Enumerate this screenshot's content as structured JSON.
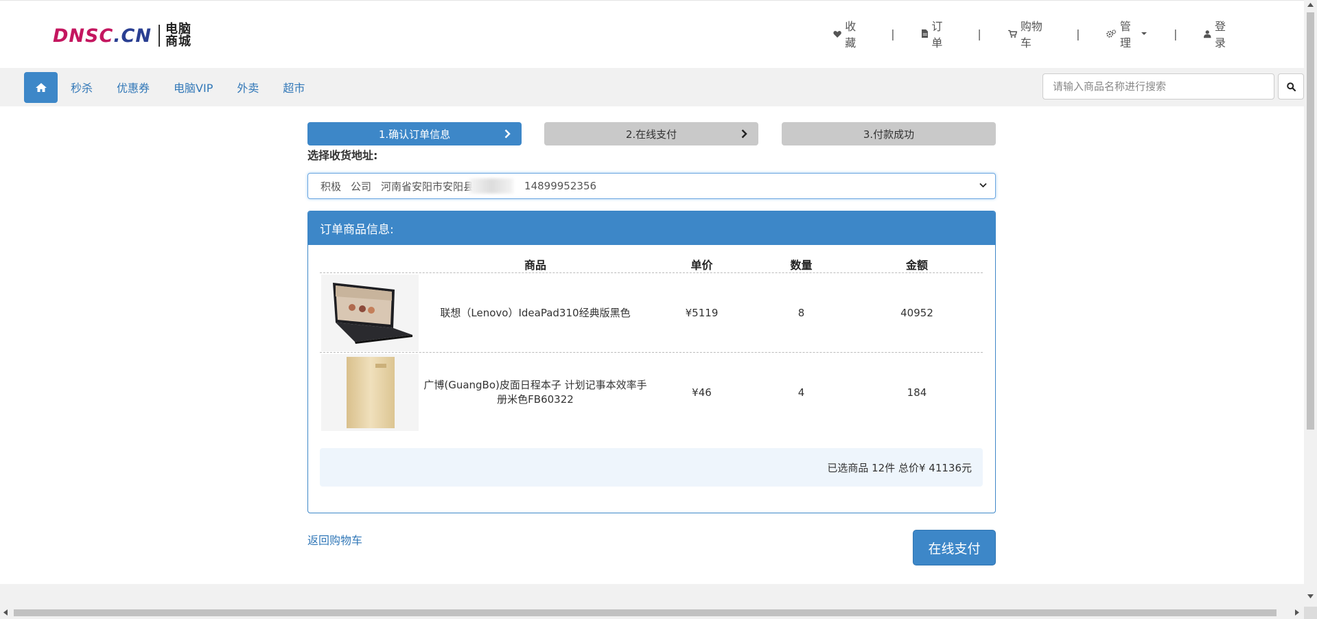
{
  "logo": {
    "part1": "DNSC",
    "part2": ".CN",
    "cn_line1": "电脑",
    "cn_line2": "商城"
  },
  "top_nav": {
    "favorites": "收藏",
    "orders": "订单",
    "cart": "购物车",
    "manage": "管理",
    "login": "登录",
    "separator": "|"
  },
  "menu": {
    "items": [
      "秒杀",
      "优惠券",
      "电脑VIP",
      "外卖",
      "超市"
    ]
  },
  "search": {
    "placeholder": "请输入商品名称进行搜索"
  },
  "steps": [
    "1.确认订单信息",
    "2.在线支付",
    "3.付款成功"
  ],
  "address": {
    "label": "选择收货地址:",
    "name": "积极",
    "company": "公司",
    "location": "河南省安阳市安阳县",
    "phone": "14899952356"
  },
  "panel": {
    "title": "订单商品信息:",
    "columns": {
      "name": "商品",
      "price": "单价",
      "qty": "数量",
      "amount": "金额"
    },
    "rows": [
      {
        "name": "联想（Lenovo）IdeaPad310经典版黑色",
        "price": "¥5119",
        "qty": "8",
        "amount": "40952",
        "thumb_icon": "laptop-icon"
      },
      {
        "name": "广博(GuangBo)皮面日程本子 计划记事本效率手册米色FB60322",
        "price": "¥46",
        "qty": "4",
        "amount": "184",
        "thumb_icon": "notebook-icon"
      }
    ],
    "summary": "已选商品 12件 总价¥ 41136元"
  },
  "actions": {
    "back": "返回购物车",
    "pay": "在线支付"
  },
  "colors": {
    "primary": "#3d87c8",
    "link": "#3278b8",
    "logo_pink": "#c4165f",
    "logo_navy": "#2a3f92"
  }
}
